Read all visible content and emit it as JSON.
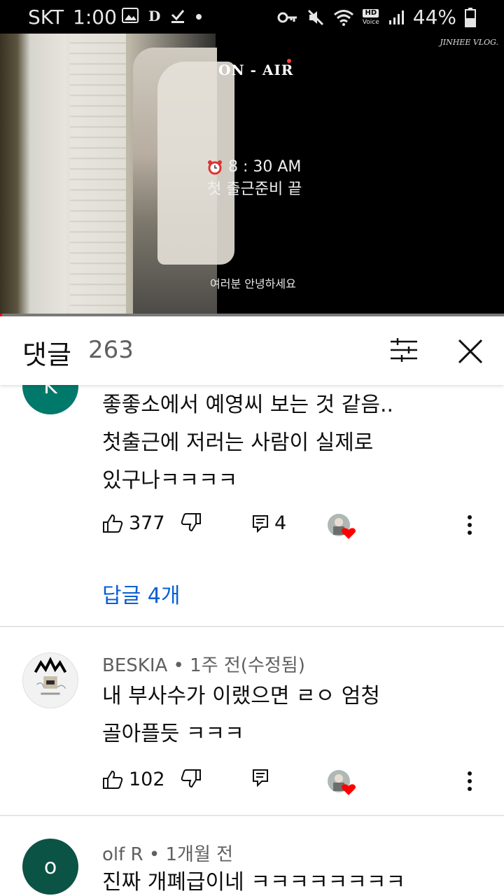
{
  "status_bar": {
    "carrier": "SKT",
    "time": "1:00",
    "battery": "44%",
    "hd_label": "HD",
    "voice_label": "Voice"
  },
  "video": {
    "title_overlay": "ON - AIR",
    "channel_watermark": "JINHEE VLOG.",
    "time_overlay": "8 : 30 AM",
    "subtitle_overlay": "첫 출근준비 끝",
    "caption": "여러분 안녕하세요",
    "progress": 0.004
  },
  "comments_header": {
    "title": "댓글",
    "count": "263"
  },
  "comments": [
    {
      "avatar_letter": "K",
      "avatar_color": "#00796b",
      "text_lines": [
        "좋좋소에서 예영씨 보는 것 같음..",
        "첫출근에 저러는 사람이 실제로",
        "있구나ㅋㅋㅋㅋ"
      ],
      "likes": "377",
      "replies_count": "4",
      "replies_link": "답글 4개"
    },
    {
      "author": "BESKIA",
      "time": "1주 전(수정됨)",
      "text_lines": [
        "내 부사수가 이랬으면 ㄹㅇ 엄청",
        "골아플듯 ㅋㅋㅋ"
      ],
      "likes": "102"
    },
    {
      "avatar_letter": "o",
      "avatar_color": "#0b5345",
      "author": "olf R",
      "time": "1개월 전",
      "text_lines": [
        "진짜 개폐급이네 ㅋㅋㅋㅋㅋㅋㅋㅋ"
      ]
    }
  ],
  "colors": {
    "link": "#065fd4",
    "heart": "#ff0000",
    "progress": "#ff0000"
  }
}
